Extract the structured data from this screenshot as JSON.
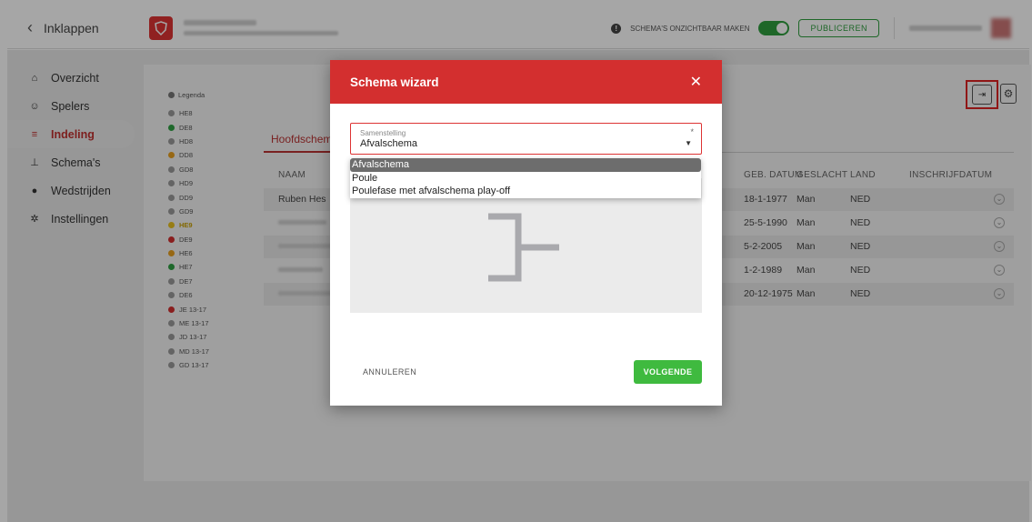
{
  "topbar": {
    "back_label": "Inklappen",
    "visibility_label": "SCHEMA'S ONZICHTBAAR MAKEN",
    "publish_label": "PUBLICEREN"
  },
  "sidebar": {
    "items": [
      {
        "label": "Overzicht",
        "icon": "home-icon"
      },
      {
        "label": "Spelers",
        "icon": "players-icon"
      },
      {
        "label": "Indeling",
        "icon": "list-icon"
      },
      {
        "label": "Schema's",
        "icon": "bracket-icon"
      },
      {
        "label": "Wedstrijden",
        "icon": "shuttle-icon"
      },
      {
        "label": "Instellingen",
        "icon": "gear-icon"
      }
    ],
    "active_index": 2
  },
  "legend": {
    "title": "Legenda",
    "items": [
      {
        "label": "HE8",
        "color": "#9a9a9a"
      },
      {
        "label": "DE8",
        "color": "#2ea043"
      },
      {
        "label": "HD8",
        "color": "#9a9a9a"
      },
      {
        "label": "DD8",
        "color": "#e8a020"
      },
      {
        "label": "GD8",
        "color": "#9a9a9a"
      },
      {
        "label": "HD9",
        "color": "#9a9a9a"
      },
      {
        "label": "DD9",
        "color": "#9a9a9a"
      },
      {
        "label": "GD9",
        "color": "#9a9a9a"
      },
      {
        "label": "HE9",
        "color": "#e8c020"
      },
      {
        "label": "DE9",
        "color": "#d32f2f"
      },
      {
        "label": "HE6",
        "color": "#e8a020"
      },
      {
        "label": "HE7",
        "color": "#2ea043"
      },
      {
        "label": "DE7",
        "color": "#9a9a9a"
      },
      {
        "label": "DE6",
        "color": "#9a9a9a"
      },
      {
        "label": "JE 13-17",
        "color": "#d32f2f"
      },
      {
        "label": "ME 13-17",
        "color": "#9a9a9a"
      },
      {
        "label": "JD 13-17",
        "color": "#9a9a9a"
      },
      {
        "label": "MD 13-17",
        "color": "#9a9a9a"
      },
      {
        "label": "GD 13-17",
        "color": "#9a9a9a"
      }
    ]
  },
  "main": {
    "tab_label": "Hoofdschema",
    "columns": {
      "naam": "NAAM",
      "geb": "GEB. DATUM",
      "geslacht": "GESLACHT",
      "land": "LAND",
      "inschrijf": "INSCHRIJFDATUM"
    },
    "rows": [
      {
        "naam": "Ruben Hes",
        "geb": "18-1-1977",
        "geslacht": "Man",
        "land": "NED"
      },
      {
        "naam": "",
        "geb": "25-5-1990",
        "geslacht": "Man",
        "land": "NED"
      },
      {
        "naam": "",
        "geb": "5-2-2005",
        "geslacht": "Man",
        "land": "NED"
      },
      {
        "naam": "",
        "geb": "1-2-1989",
        "geslacht": "Man",
        "land": "NED"
      },
      {
        "naam": "",
        "geb": "20-12-1975",
        "geslacht": "Man",
        "land": "NED"
      }
    ]
  },
  "modal": {
    "title": "Schema wizard",
    "field_label": "Samenstelling",
    "field_value": "Afvalschema",
    "required_mark": "*",
    "options": [
      "Afvalschema",
      "Poule",
      "Poulefase met afvalschema play-off"
    ],
    "cancel_label": "ANNULEREN",
    "next_label": "VOLGENDE"
  }
}
